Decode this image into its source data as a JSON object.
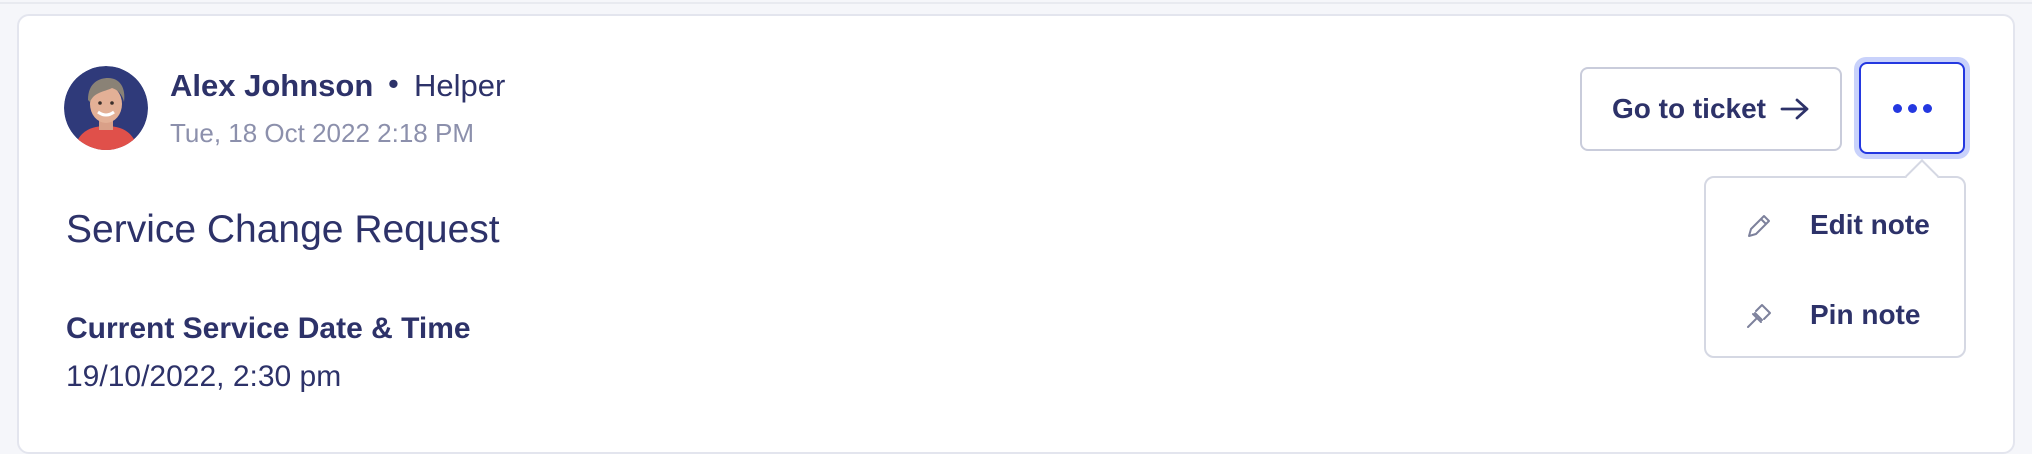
{
  "note": {
    "author": {
      "name": "Alex Johnson",
      "separator": "•",
      "role": "Helper",
      "avatar_icon": "user-avatar"
    },
    "timestamp": "Tue, 18 Oct 2022 2:18 PM",
    "title": "Service Change Request",
    "fields": [
      {
        "label": "Current Service Date & Time",
        "value": "19/10/2022, 2:30 pm"
      }
    ]
  },
  "actions": {
    "go_to_ticket_label": "Go to ticket",
    "go_to_ticket_icon": "arrow-right-icon",
    "more_icon": "more-horizontal-icon"
  },
  "menu": {
    "items": [
      {
        "label": "Edit note",
        "icon": "pencil-icon"
      },
      {
        "label": "Pin note",
        "icon": "pin-icon"
      }
    ]
  },
  "colors": {
    "text": "#2d3269",
    "muted": "#8c90ac",
    "accent": "#2438e0",
    "focus_ring": "#c9d2fb",
    "border": "#c9ccdb"
  }
}
